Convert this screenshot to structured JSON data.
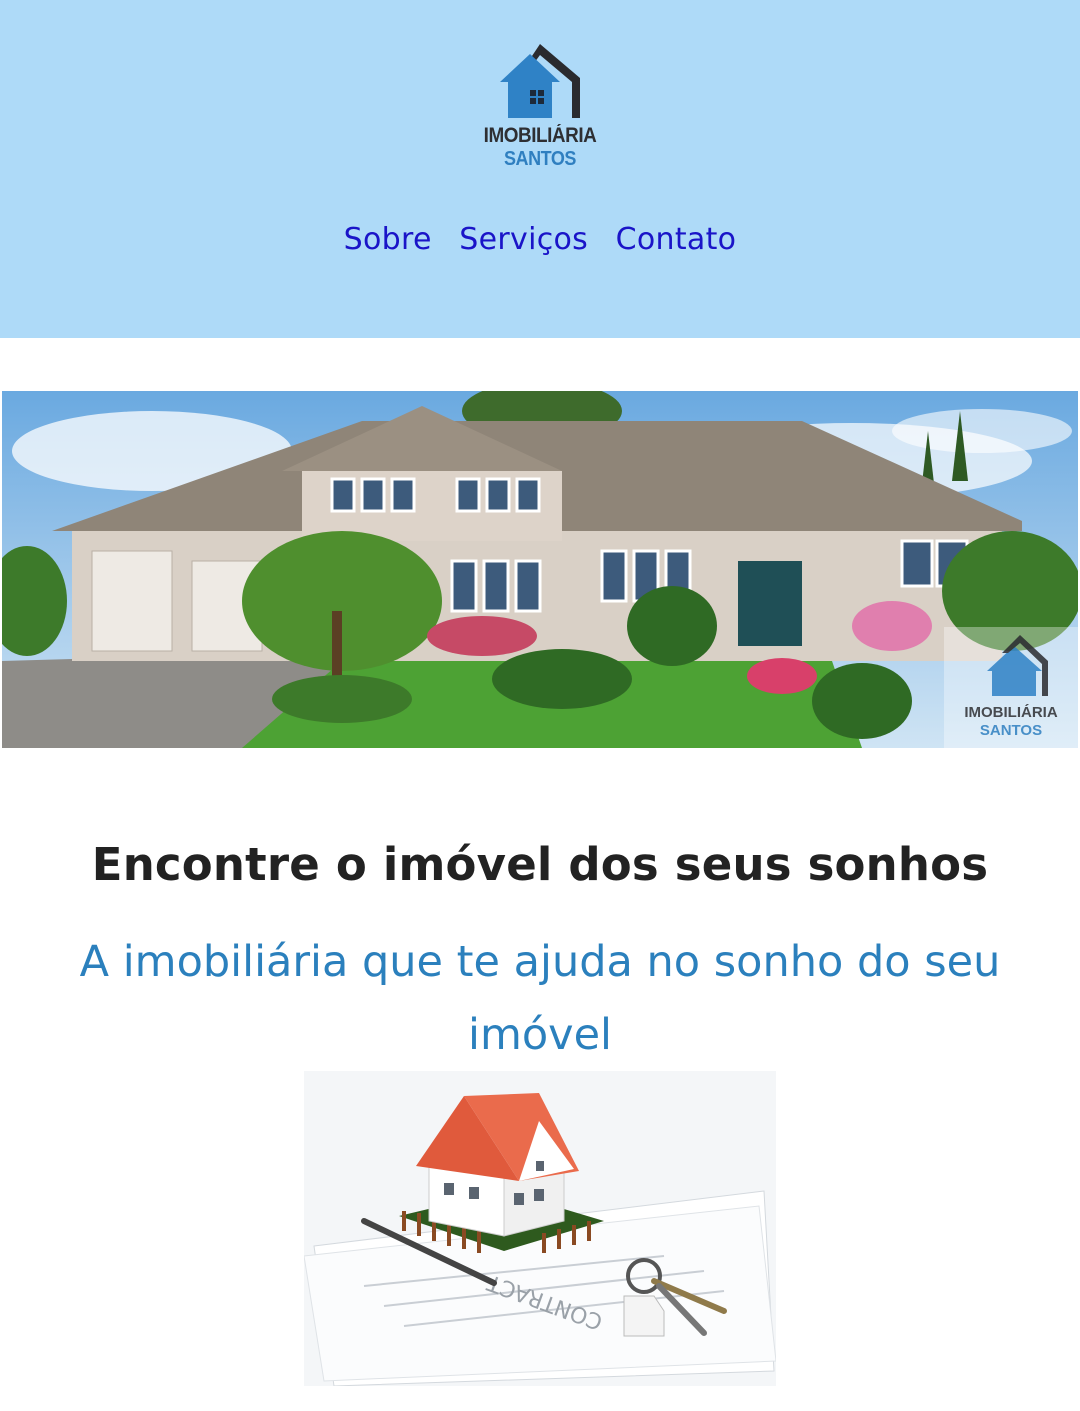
{
  "brand": {
    "name_line1": "IMOBILIÁRIA",
    "name_line2": "SANTOS",
    "logo_icon": "house-logo-icon"
  },
  "nav": {
    "items": [
      {
        "label": "Sobre"
      },
      {
        "label": "Serviços"
      },
      {
        "label": "Contato"
      }
    ]
  },
  "hero": {
    "watermark_line1": "IMOBILIÁRIA",
    "watermark_line2": "SANTOS"
  },
  "main": {
    "headline": "Encontre o imóvel dos seus sonhos",
    "subheadline": "A imobiliária que te ajuda no sonho do seu imóvel"
  },
  "contract_image": {
    "document_text": "CONTRACT"
  },
  "colors": {
    "header_bg": "#aedaf8",
    "nav_link": "#1a14c8",
    "accent_blue": "#2b80bd",
    "headline": "#222222"
  }
}
